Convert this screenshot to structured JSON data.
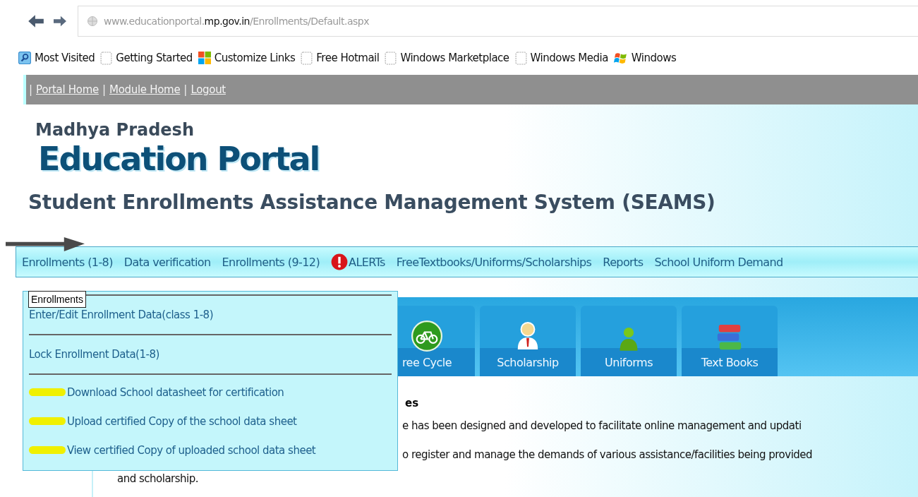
{
  "browser": {
    "url": "www.educationportal.**mp.gov.in**/Enrollments/Default.aspx"
  },
  "bookmarks": [
    {
      "label": "Most Visited",
      "kind": "search"
    },
    {
      "label": "Getting Started",
      "kind": "page"
    },
    {
      "label": "Customize Links",
      "kind": "tiles"
    },
    {
      "label": "Free Hotmail",
      "kind": "page"
    },
    {
      "label": "Windows Marketplace",
      "kind": "page"
    },
    {
      "label": "Windows Media",
      "kind": "page"
    },
    {
      "label": "Windows",
      "kind": "flag"
    }
  ],
  "top_nav": {
    "separator": "|",
    "links": [
      "Portal Home",
      "Module Home",
      "Logout"
    ]
  },
  "header": {
    "state": "Madhya Pradesh",
    "title": "Education Portal",
    "system": "Student Enrollments Assistance Management System (SEAMS)"
  },
  "menu": [
    {
      "label": "Enrollments (1-8)",
      "kind": "text"
    },
    {
      "label": "Data verification",
      "kind": "text"
    },
    {
      "label": "Enrollments (9-12)",
      "kind": "text"
    },
    {
      "label": "ALERTs",
      "kind": "alert"
    },
    {
      "label": "FreeTextbooks/Uniforms/Scholarships",
      "kind": "text"
    },
    {
      "label": "Reports",
      "kind": "text"
    },
    {
      "label": "School Uniform Demand",
      "kind": "text"
    }
  ],
  "tooltip": "Enrollments",
  "dropdown": [
    {
      "label": "Enter/Edit Enrollment Data(class 1-8)",
      "kind": "plain"
    },
    {
      "label": "Lock Enrollment Data(1-8)",
      "kind": "plain"
    },
    {
      "label": "Download School datasheet for certification",
      "kind": "marked"
    },
    {
      "label": "Upload certified Copy of the school data sheet",
      "kind": "marked"
    },
    {
      "label": "View certified Copy of uploaded school data sheet",
      "kind": "marked"
    }
  ],
  "tabs": [
    {
      "label": "ree Cycle",
      "kind": "bicycle"
    },
    {
      "label": "Scholarship",
      "kind": "student"
    },
    {
      "label": "Uniforms",
      "kind": "person"
    },
    {
      "label": "Text Books",
      "kind": "books"
    }
  ],
  "content": {
    "heading": "es",
    "lines": [
      "e  has been designed and developed to facilitate  online management and updati",
      "o register and manage the demands of various assistance/facilities being provided",
      "and scholarship."
    ]
  }
}
